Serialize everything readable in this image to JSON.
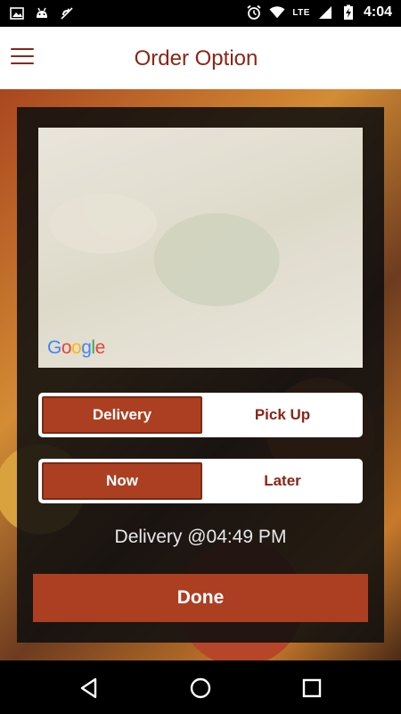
{
  "status_bar": {
    "left_icons": [
      "image-icon",
      "android-icon",
      "no-sync-icon"
    ],
    "right_icons": [
      "alarm-icon",
      "wifi-icon",
      "signal-icon",
      "battery-charging-icon"
    ],
    "network": "LTE",
    "time": "4:04"
  },
  "app_bar": {
    "title": "Order Option",
    "menu_icon": "hamburger-menu-icon"
  },
  "map": {
    "provider_logo": "Google"
  },
  "order_type": {
    "options": [
      {
        "label": "Delivery",
        "selected": true
      },
      {
        "label": "Pick Up",
        "selected": false
      }
    ]
  },
  "timing": {
    "options": [
      {
        "label": "Now",
        "selected": true
      },
      {
        "label": "Later",
        "selected": false
      }
    ]
  },
  "info_text": "Delivery @04:49 PM",
  "done_label": "Done",
  "colors": {
    "accent": "#ac3f22",
    "title": "#8b2516"
  },
  "nav_bar": {
    "icons": [
      "back-icon",
      "home-icon",
      "recents-icon"
    ]
  }
}
